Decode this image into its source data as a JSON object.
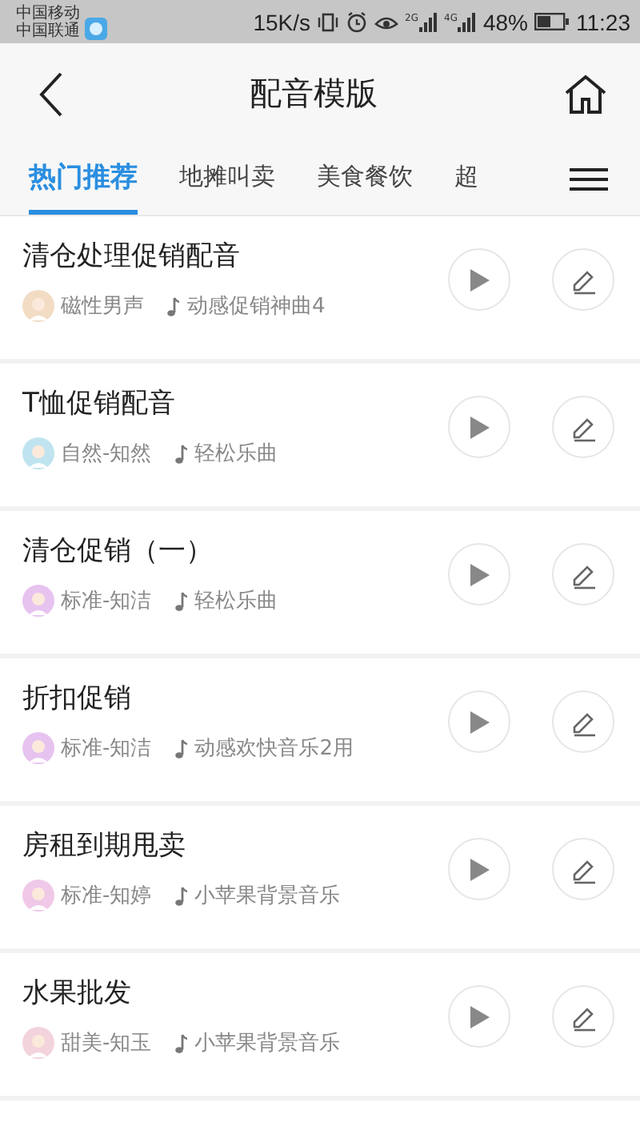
{
  "status_bar": {
    "carriers": [
      "中国移动",
      "中国联通"
    ],
    "speed": "15K/s",
    "signal_labels": [
      "2G",
      "4G"
    ],
    "battery": "48%",
    "time": "11:23"
  },
  "header": {
    "title": "配音模版"
  },
  "tabs": [
    {
      "label": "热门推荐",
      "selected": true
    },
    {
      "label": "地摊叫卖",
      "selected": false
    },
    {
      "label": "美食餐饮",
      "selected": false
    },
    {
      "label": "超",
      "selected": false
    }
  ],
  "items": [
    {
      "title": "清仓处理促销配音",
      "voice": "磁性男声",
      "color": "#f2dcc4",
      "music": "动感促销神曲4"
    },
    {
      "title": "T恤促销配音",
      "voice": "自然-知然",
      "color": "#bfe4f0",
      "music": "轻松乐曲"
    },
    {
      "title": "清仓促销（一）",
      "voice": "标准-知洁",
      "color": "#e7c3f0",
      "music": "轻松乐曲"
    },
    {
      "title": "折扣促销",
      "voice": "标准-知洁",
      "color": "#e7c3f0",
      "music": "动感欢快音乐2用"
    },
    {
      "title": "房租到期甩卖",
      "voice": "标准-知婷",
      "color": "#f0c8e8",
      "music": "小苹果背景音乐"
    },
    {
      "title": "水果批发",
      "voice": "甜美-知玉",
      "color": "#f3d3dc",
      "music": "小苹果背景音乐"
    }
  ]
}
